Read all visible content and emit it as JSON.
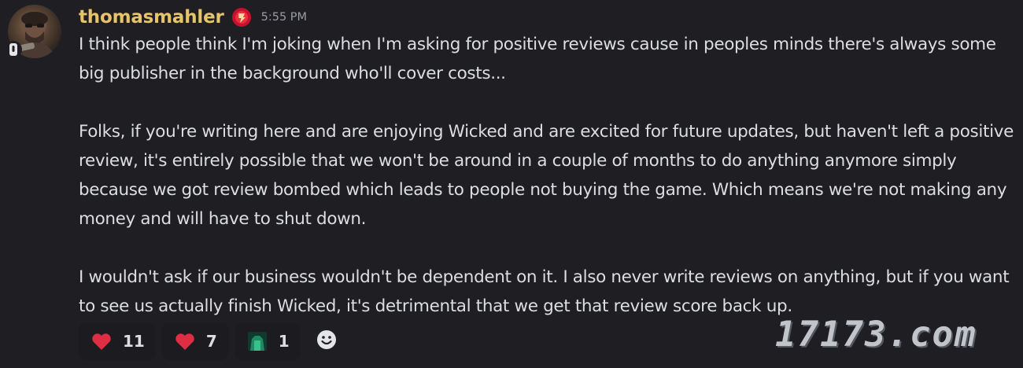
{
  "message": {
    "author": {
      "username": "thomasmahler",
      "avatar": "user-avatar",
      "badge_icon": "red-badge-icon",
      "status_icon": "mobile-status-icon"
    },
    "timestamp": "5:55 PM",
    "paragraphs": [
      "I think people think I'm joking when I'm asking for positive reviews cause in peoples minds there's always some big publisher in the background who'll cover costs...",
      "Folks, if you're writing here and are enjoying Wicked and are excited for future updates, but haven't left a positive review, it's entirely possible that we won't be around in a couple of months to do anything anymore simply because we got review bombed which leads to people not buying the game. Which means we're not making any money and will have to shut down.",
      "I wouldn't ask if our business wouldn't be dependent on it. I also never write reviews on anything, but if you want to see us actually finish Wicked, it's detrimental that we get that review score back up."
    ],
    "reactions": [
      {
        "emoji": "red-heart-icon",
        "count": "11"
      },
      {
        "emoji": "red-heart-icon",
        "count": "7"
      },
      {
        "emoji": "green-custom-emoji-icon",
        "count": "1"
      }
    ],
    "add_reaction_icon": "smiley-add-reaction-icon"
  },
  "watermark": "17173.com",
  "colors": {
    "background": "#1e1e23",
    "username": "#e7c36c",
    "text": "#dcdee2",
    "timestamp": "#9a9ca3",
    "heart": "#dd2e44"
  }
}
